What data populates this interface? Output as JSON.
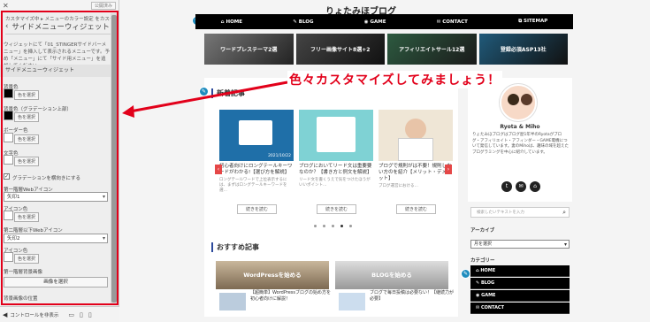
{
  "customizer": {
    "close_label": "✕",
    "publish_label": "公開済み",
    "breadcrumb": "カスタマイズ中 ▸ メニューのカラー設定 をカスタマイズし…",
    "section_title": "サイドメニューウィジェット",
    "description": "ウィジェットにて「01_STINGERサイドバーメニュー」を挿入して表示されるメニューです。予め「メニュー」にて「サイド用メニュー」を追加してください。",
    "subheading": "サイドメニューウィジェット",
    "bg_label": "背景色",
    "bg_grad_label": "背景色（グラデーション上部）",
    "border_label": "ボーダー色",
    "text_label": "文字色",
    "select_color": "色を選択",
    "gradient_label": "グラデーションを横向きにする",
    "icon1_label": "第一階層Webアイコン",
    "icon1_value": "矢印1",
    "icon_color_label": "アイコン色",
    "icon2_label": "第二階層以下Webアイコン",
    "icon2_value": "矢印2",
    "icon_color2_label": "アイコン色",
    "bgimg1_label": "第一階層背景画像",
    "select_image": "画像を選択",
    "bgimg1_pos_label": "背景画像の位置",
    "hide_controls": "コントロールを非表示"
  },
  "preview": {
    "blog_title": "りょたみほブログ",
    "nav": [
      "HOME",
      "BLOG",
      "GAME",
      "CONTACT",
      "SITEMAP"
    ],
    "banners": [
      "ワードプレステーマ2選",
      "フリー画像サイト8選+2",
      "アフィリエイトサール12選",
      "登録必須ASP13社"
    ],
    "new_heading": "新着記事",
    "cards": [
      {
        "title": "初心者向けにロングテールキーワードがわかる!【選び方を解説】",
        "excerpt": "ロングテールワードで上位表示するには、まずはロングテールキーワードを選…",
        "date": "2021/10/22"
      },
      {
        "title": "ブログにおいてリード文は重要要なのか？【書き方と例文を解説】",
        "excerpt": "リード文を書くうえで気をつけたほうがいいポイント…"
      },
      {
        "title": "ブログで規則がは不要！規則しない方のを紹介【メリット・デメリット】",
        "excerpt": "ブログ運営における…"
      }
    ],
    "read_more": "続きを読む",
    "recommend_heading": "おすすめ記事",
    "recommend": [
      {
        "banner": "WordPressを始める",
        "title": "【超簡単】WordPressブログの始め方を初心者向けに解説！"
      },
      {
        "banner": "BLOGを始める",
        "title": "ブログで毎日投稿は必要ない！【継続力が必要】"
      }
    ],
    "profile_name": "Ryota & Miho",
    "profile_desc": "りょたみほブログはブログ歴1年半のRyotaがブログ・アフィリエイト・アフィンダー・GAME電機について発信しています。妻のMihoは、趣味の域を超えたブログラミングを中心に紹介しています。",
    "search_placeholder": "検索したいテキストを入力",
    "archive_title": "アーカイブ",
    "archive_select": "月を選択",
    "category_title": "カテゴリー",
    "categories": [
      "HOME",
      "BLOG",
      "GAME",
      "CONTACT"
    ]
  },
  "annotation": "色々カスタマイズしてみましょう！",
  "colors": {
    "accent_red": "#e2001a",
    "nav_black": "#000000",
    "heading_blue": "#2c4a9c"
  }
}
